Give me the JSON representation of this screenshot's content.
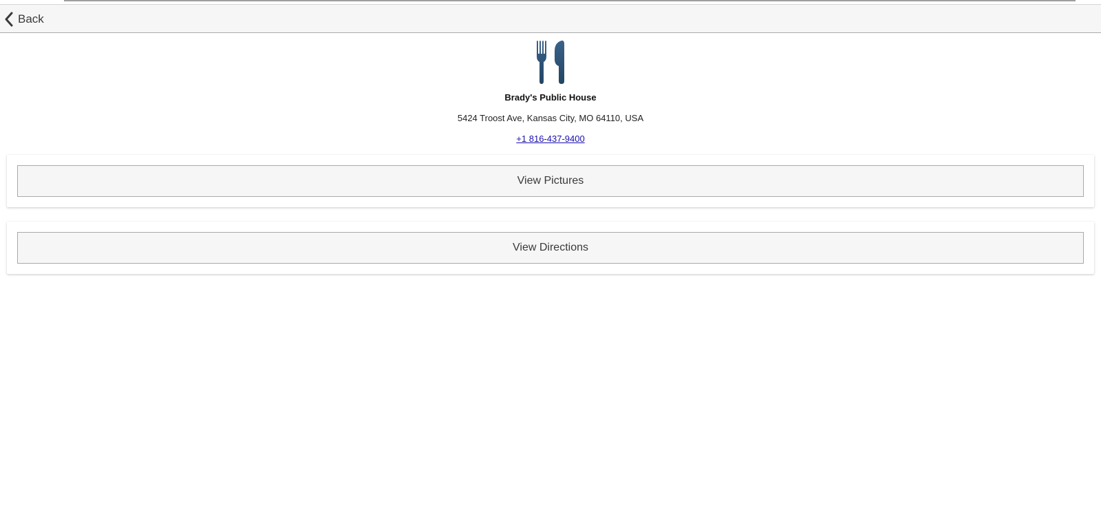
{
  "header": {
    "back_label": "Back"
  },
  "place": {
    "icon": "fork-knife-icon",
    "name": "Brady's Public House",
    "address": "5424 Troost Ave, Kansas City, MO 64110, USA",
    "phone": "+1 816-437-9400"
  },
  "actions": {
    "view_pictures_label": "View Pictures",
    "view_directions_label": "View Directions"
  },
  "colors": {
    "icon": "#2b4f72",
    "link": "#1a0dab"
  }
}
